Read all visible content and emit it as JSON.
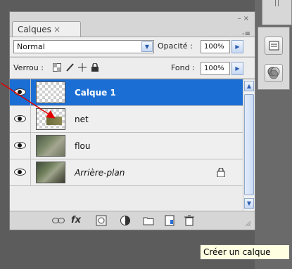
{
  "panel": {
    "tab_label": "Calques",
    "tab_close": "×",
    "panel_controls": "– ×",
    "menu_icon": "-≡"
  },
  "blend": {
    "mode": "Normal",
    "opacity_label": "Opacité :",
    "opacity_value": "100%"
  },
  "lock": {
    "label": "Verrou :",
    "fill_label": "Fond :",
    "fill_value": "100%"
  },
  "layers": [
    {
      "name": "Calque 1",
      "selected": true,
      "visible": true,
      "thumb": "transparent-icon"
    },
    {
      "name": "net",
      "selected": false,
      "visible": true,
      "thumb": "image-icon"
    },
    {
      "name": "flou",
      "selected": false,
      "visible": true,
      "thumb": "image-icon"
    },
    {
      "name": "Arrière-plan",
      "selected": false,
      "visible": true,
      "thumb": "image-icon",
      "locked": true
    }
  ],
  "toolbar": {
    "icons": [
      "link-icon",
      "fx-icon",
      "mask-icon",
      "adjustment-icon",
      "folder-icon",
      "new-layer-icon",
      "trash-icon"
    ],
    "fx_label": "fx"
  },
  "tooltip": "Créer un calque",
  "annotation_color": "#e00000",
  "selection_color": "#1b6ed3"
}
